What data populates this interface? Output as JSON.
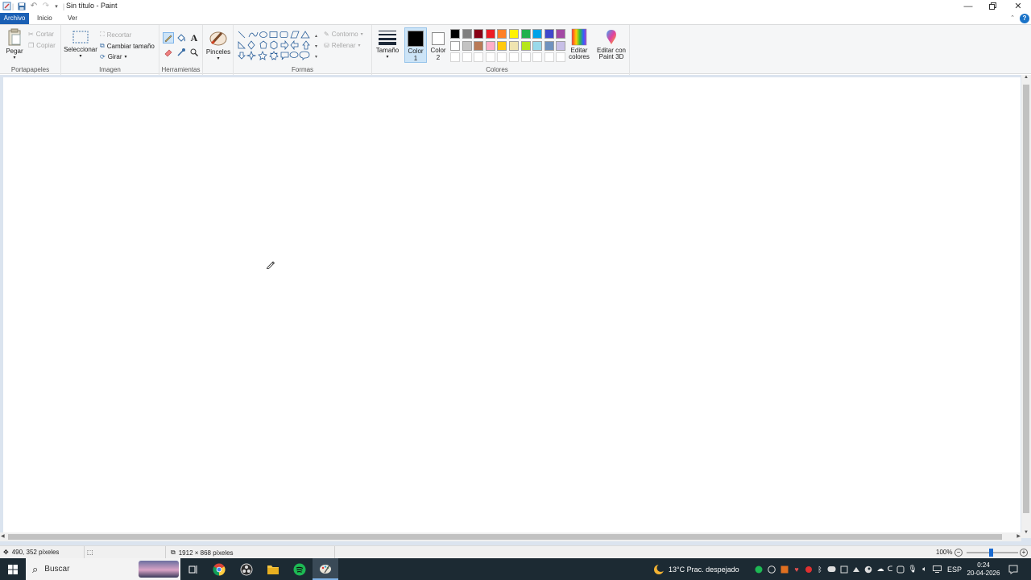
{
  "window": {
    "title": "Sin título - Paint"
  },
  "tabs": {
    "archivo": "Archivo",
    "inicio": "Inicio",
    "ver": "Ver"
  },
  "ribbon": {
    "clipboard": {
      "paste": "Pegar",
      "cut": "Cortar",
      "copy": "Copiar",
      "group": "Portapapeles"
    },
    "image": {
      "select": "Seleccionar",
      "crop": "Recortar",
      "resize": "Cambiar tamaño",
      "rotate": "Girar",
      "group": "Imagen"
    },
    "tools": {
      "group": "Herramientas"
    },
    "brushes": {
      "label": "Pinceles"
    },
    "shapes": {
      "outline": "Contorno",
      "fill": "Rellenar",
      "group": "Formas"
    },
    "size": {
      "label": "Tamaño"
    },
    "colors": {
      "color1": "Color 1",
      "color1_value": "#000000",
      "color2": "Color 2",
      "color2_value": "#ffffff",
      "edit": "Editar colores",
      "paint3d": "Editar con Paint 3D",
      "group": "Colores",
      "palette_row1": [
        "#000000",
        "#7f7f7f",
        "#880015",
        "#ed1c24",
        "#ff7f27",
        "#fff200",
        "#22b14c",
        "#00a2e8",
        "#3f48cc",
        "#a349a4"
      ],
      "palette_row2": [
        "#ffffff",
        "#c3c3c3",
        "#b97a57",
        "#ffaec9",
        "#ffc90e",
        "#efe4b0",
        "#b5e61d",
        "#99d9ea",
        "#7092be",
        "#c8bfe7"
      ]
    }
  },
  "status": {
    "cursor_pos": "490, 352 píxeles",
    "canvas_size": "1912 × 868 píxeles",
    "zoom": "100%"
  },
  "taskbar": {
    "search": "Buscar",
    "weather": "13°C  Prac. despejado",
    "lang": "ESP",
    "time": "0:24",
    "date": "20-04-2026"
  }
}
